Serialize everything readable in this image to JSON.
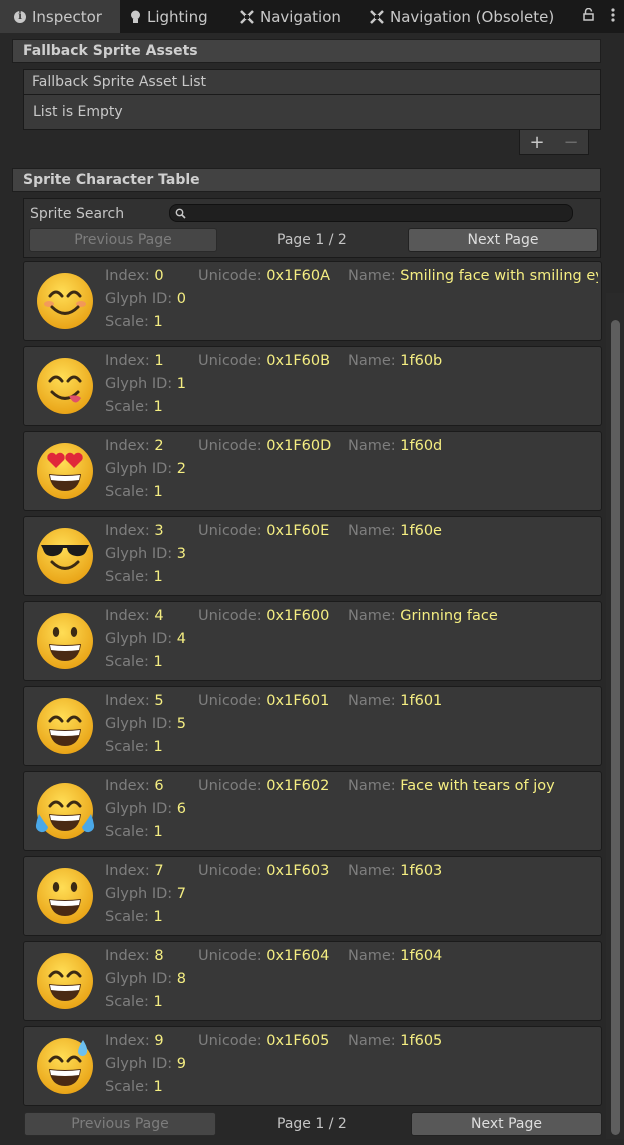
{
  "tabs": [
    {
      "label": "Inspector",
      "icon": "info-icon",
      "active": true
    },
    {
      "label": "Lighting",
      "icon": "lightbulb-icon",
      "active": false
    },
    {
      "label": "Navigation",
      "icon": "navigation-icon",
      "active": false
    },
    {
      "label": "Navigation (Obsolete)",
      "icon": "navigation-icon",
      "active": false
    }
  ],
  "tab_actions": {
    "lock_icon": "lock-icon",
    "menu_icon": "kebab-menu-icon"
  },
  "fallback": {
    "header": "Fallback Sprite Assets",
    "list_title": "Fallback Sprite Asset List",
    "empty_text": "List is Empty",
    "add_label": "+",
    "remove_label": "−"
  },
  "sprite_table": {
    "header": "Sprite Character Table",
    "search_label": "Sprite Search",
    "search_value": "",
    "search_icon": "search-icon",
    "top_pager": {
      "prev": "Previous Page",
      "page": "Page 1 / 2",
      "next": "Next Page"
    },
    "bottom_pager": {
      "prev": "Previous Page",
      "page": "Page 1 / 2",
      "next": "Next Page"
    },
    "labels": {
      "index": "Index: ",
      "glyph": "Glyph ID: ",
      "scale": "Scale: ",
      "unicode": "Unicode: ",
      "name": "Name: "
    },
    "rows": [
      {
        "index": "0",
        "glyph": "0",
        "scale": "1",
        "unicode": "0x1F60A",
        "name": "Smiling face with smiling eyes",
        "emoji": "smiling-eyes"
      },
      {
        "index": "1",
        "glyph": "1",
        "scale": "1",
        "unicode": "0x1F60B",
        "name": "1f60b",
        "emoji": "savoring-food"
      },
      {
        "index": "2",
        "glyph": "2",
        "scale": "1",
        "unicode": "0x1F60D",
        "name": "1f60d",
        "emoji": "heart-eyes"
      },
      {
        "index": "3",
        "glyph": "3",
        "scale": "1",
        "unicode": "0x1F60E",
        "name": "1f60e",
        "emoji": "sunglasses"
      },
      {
        "index": "4",
        "glyph": "4",
        "scale": "1",
        "unicode": "0x1F600",
        "name": "Grinning face",
        "emoji": "grinning"
      },
      {
        "index": "5",
        "glyph": "5",
        "scale": "1",
        "unicode": "0x1F601",
        "name": "1f601",
        "emoji": "beaming"
      },
      {
        "index": "6",
        "glyph": "6",
        "scale": "1",
        "unicode": "0x1F602",
        "name": "Face with tears of joy",
        "emoji": "tears-of-joy"
      },
      {
        "index": "7",
        "glyph": "7",
        "scale": "1",
        "unicode": "0x1F603",
        "name": "1f603",
        "emoji": "grinning-big-eyes"
      },
      {
        "index": "8",
        "glyph": "8",
        "scale": "1",
        "unicode": "0x1F604",
        "name": "1f604",
        "emoji": "grinning-smiling-eyes"
      },
      {
        "index": "9",
        "glyph": "9",
        "scale": "1",
        "unicode": "0x1F605",
        "name": "1f605",
        "emoji": "grinning-sweat"
      }
    ]
  },
  "colors": {
    "value_yellow": "#f5ee82",
    "label_gray": "#7e7e7e",
    "emoji_yellow": "#f6c531"
  }
}
